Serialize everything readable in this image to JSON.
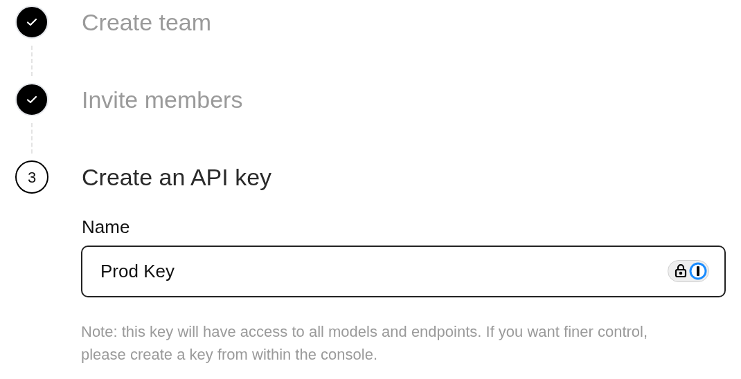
{
  "steps": [
    {
      "title": "Create team",
      "completed": true
    },
    {
      "title": "Invite members",
      "completed": true
    },
    {
      "title": "Create an API key",
      "completed": false,
      "number": "3"
    }
  ],
  "form": {
    "label": "Name",
    "value": "Prod Key",
    "note": "Note: this key will have access to all models and endpoints. If you want finer control, please create a key from within the console."
  }
}
